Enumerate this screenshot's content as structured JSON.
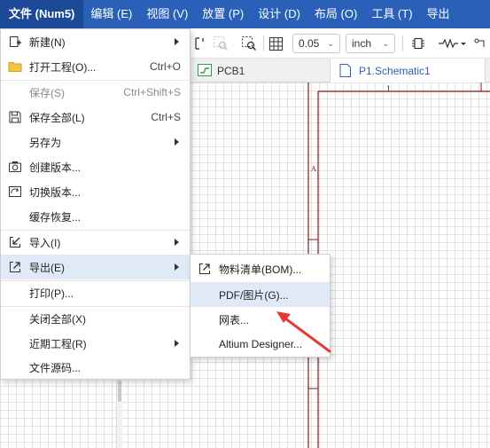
{
  "menubar": {
    "items": [
      {
        "label": "文件 (Num5)"
      },
      {
        "label": "编辑 (E)"
      },
      {
        "label": "视图 (V)"
      },
      {
        "label": "放置 (P)"
      },
      {
        "label": "设计 (D)"
      },
      {
        "label": "布局 (O)"
      },
      {
        "label": "工具 (T)"
      },
      {
        "label": "导出"
      }
    ]
  },
  "toolbar": {
    "grid_size": "0.05",
    "unit": "inch"
  },
  "tabs": [
    {
      "label": "PCB1"
    },
    {
      "label": "P1.Schematic1"
    }
  ],
  "sheet": {
    "column_marker": "1",
    "row_marker": "A"
  },
  "file_menu": {
    "items": [
      {
        "label": "新建(N)",
        "shortcut": "",
        "submenu": true,
        "icon": "new-file-icon"
      },
      {
        "label": "打开工程(O)...",
        "shortcut": "Ctrl+O",
        "submenu": false,
        "icon": "folder-icon"
      },
      {
        "label": "保存(S)",
        "shortcut": "Ctrl+Shift+S",
        "submenu": false,
        "icon": "",
        "disabled": true
      },
      {
        "label": "保存全部(L)",
        "shortcut": "Ctrl+S",
        "submenu": false,
        "icon": "save-icon"
      },
      {
        "label": "另存为",
        "shortcut": "",
        "submenu": true,
        "icon": ""
      },
      {
        "label": "创建版本...",
        "shortcut": "",
        "submenu": false,
        "icon": "camera-icon"
      },
      {
        "label": "切换版本...",
        "shortcut": "",
        "submenu": false,
        "icon": "switch-version-icon"
      },
      {
        "label": "缓存恢复...",
        "shortcut": "",
        "submenu": false,
        "icon": ""
      },
      {
        "label": "导入(I)",
        "shortcut": "",
        "submenu": true,
        "icon": "import-icon"
      },
      {
        "label": "导出(E)",
        "shortcut": "",
        "submenu": true,
        "icon": "export-icon",
        "highlighted": true
      },
      {
        "label": "打印(P)...",
        "shortcut": "",
        "submenu": false,
        "icon": ""
      },
      {
        "label": "关闭全部(X)",
        "shortcut": "",
        "submenu": false,
        "icon": ""
      },
      {
        "label": "近期工程(R)",
        "shortcut": "",
        "submenu": true,
        "icon": ""
      },
      {
        "label": "文件源码...",
        "shortcut": "",
        "submenu": false,
        "icon": ""
      }
    ]
  },
  "export_submenu": {
    "items": [
      {
        "label": "物料清单(BOM)...",
        "icon": "export-icon"
      },
      {
        "label": "PDF/图片(G)...",
        "highlighted": true
      },
      {
        "label": "网表..."
      },
      {
        "label": "Altium Designer..."
      }
    ]
  },
  "colors": {
    "menubar_bg": "#2b60b8",
    "menu_hover": "#dfe9f7",
    "sheet_border": "#8b1a1a",
    "annotation_arrow": "#e53935",
    "tab_active_text": "#2b60b8"
  }
}
